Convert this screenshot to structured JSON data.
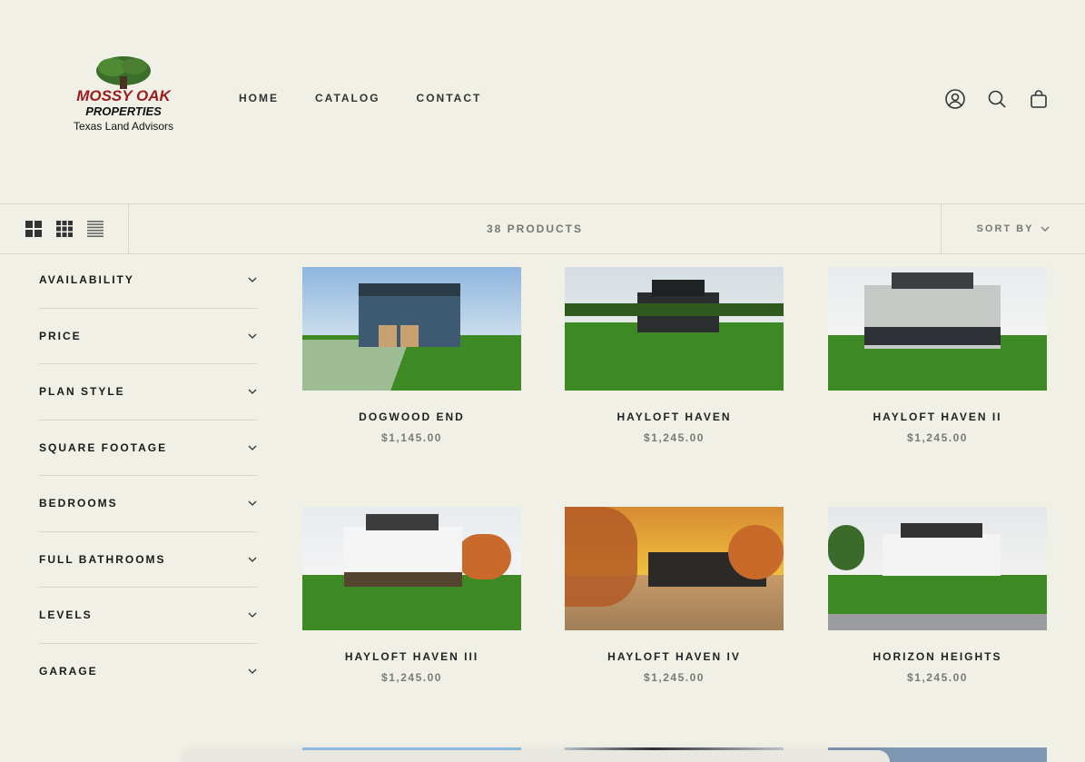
{
  "brand": {
    "line1": "MOSSY OAK",
    "line2": "PROPERTIES",
    "line3": "Texas Land Advisors"
  },
  "nav": [
    "HOME",
    "CATALOG",
    "CONTACT"
  ],
  "icons": [
    "account-icon",
    "search-icon",
    "cart-icon"
  ],
  "toolbar": {
    "count": "38 PRODUCTS",
    "sort_label": "SORT BY"
  },
  "filters": [
    "AVAILABILITY",
    "PRICE",
    "PLAN STYLE",
    "SQUARE FOOTAGE",
    "BEDROOMS",
    "FULL BATHROOMS",
    "LEVELS",
    "GARAGE"
  ],
  "products": [
    {
      "title": "DOGWOOD END",
      "price": "$1,145.00"
    },
    {
      "title": "HAYLOFT HAVEN",
      "price": "$1,245.00"
    },
    {
      "title": "HAYLOFT HAVEN II",
      "price": "$1,245.00"
    },
    {
      "title": "HAYLOFT HAVEN III",
      "price": "$1,245.00"
    },
    {
      "title": "HAYLOFT HAVEN IV",
      "price": "$1,245.00"
    },
    {
      "title": "HORIZON HEIGHTS",
      "price": "$1,245.00"
    }
  ],
  "colors": {
    "background": "#f1f0e7",
    "brand_red": "#9c1b1f",
    "grass": "#3d8a24"
  }
}
